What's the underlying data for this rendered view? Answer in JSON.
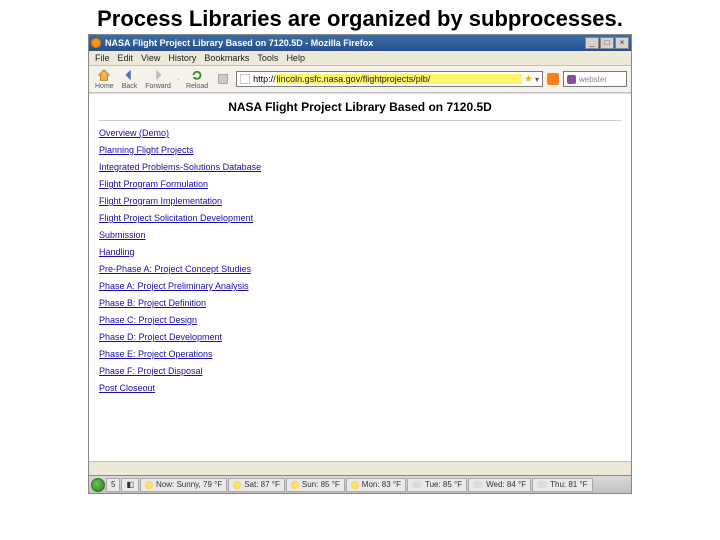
{
  "slide": {
    "title": "Process Libraries are organized by subprocesses."
  },
  "window": {
    "title": "NASA Flight Project Library Based on 7120.5D - Mozilla Firefox",
    "controls": {
      "min": "_",
      "max": "□",
      "close": "×"
    }
  },
  "menu": [
    "File",
    "Edit",
    "View",
    "History",
    "Bookmarks",
    "Tools",
    "Help"
  ],
  "toolbar": {
    "home": "Home",
    "back": "Back",
    "forward": "Forward",
    "reload": "Reload",
    "url_prefix": "http://",
    "url": "lincoln.gsfc.nasa.gov/flightprojects/plb/",
    "search_placeholder": "webster"
  },
  "page": {
    "heading": "NASA Flight Project Library Based on 7120.5D",
    "links": [
      "Overview (Demo)",
      "Planning Flight Projects",
      "Integrated Problems-Solutions Database",
      "Flight Program Formulation",
      "Flight Program Implementation",
      "Flight Project Solicitation Development",
      "Submission",
      "Handling",
      "Pre-Phase A: Project Concept Studies",
      "Phase A: Project Preliminary Analysis",
      "Phase B: Project Definition",
      "Phase C: Project Design",
      "Phase D: Project Development",
      "Phase E: Project Operations",
      "Phase F: Project Disposal",
      "Post Closeout"
    ]
  },
  "taskbar": {
    "start_count": "5",
    "items": [
      "Now: Sunny, 79 °F",
      "Sat: 87 °F",
      "Sun: 85 °F",
      "Mon: 83 °F",
      "Tue: 85 °F",
      "Wed: 84 °F",
      "Thu: 81 °F"
    ]
  }
}
